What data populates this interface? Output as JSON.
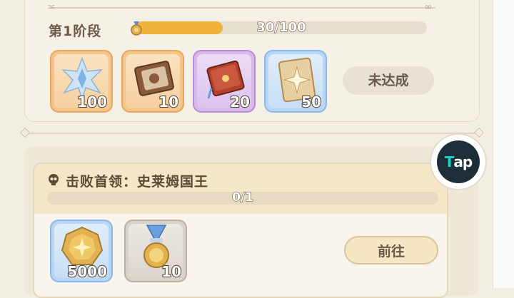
{
  "stage": {
    "title": "第1阶段",
    "progress_text": "30/100",
    "progress_fraction": 0.3,
    "rewards": [
      {
        "icon": "crystal-star-icon",
        "count": "100",
        "rarity": "orange"
      },
      {
        "icon": "leather-book-icon",
        "count": "10",
        "rarity": "orange"
      },
      {
        "icon": "red-tome-icon",
        "count": "20",
        "rarity": "purple"
      },
      {
        "icon": "sparkle-card-icon",
        "count": "50",
        "rarity": "blue"
      }
    ],
    "status_button": "未达成"
  },
  "quest": {
    "title": "击败首领：史莱姆国王",
    "progress_text": "0/1",
    "progress_fraction": 0,
    "rewards": [
      {
        "icon": "gold-coin-icon",
        "count": "5000",
        "rarity": "blue"
      },
      {
        "icon": "medal-icon",
        "count": "10",
        "rarity": "gray"
      }
    ],
    "go_button": "前往"
  },
  "floating": {
    "tap_label_a": "T",
    "tap_label_b": "ap"
  },
  "colors": {
    "progress": "#f0b43c",
    "background": "#f3eee2",
    "tap_accent": "#19d3c5"
  }
}
